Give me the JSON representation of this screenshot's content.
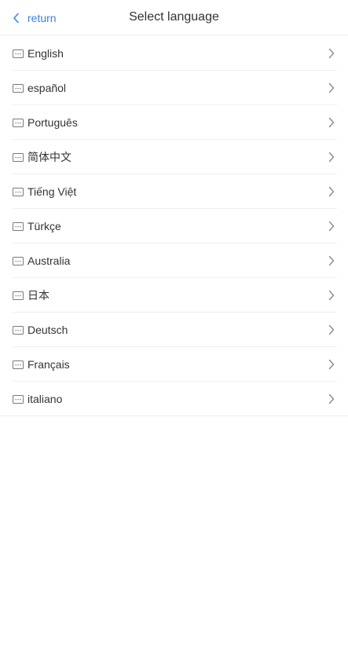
{
  "header": {
    "back_label": "return",
    "title": "Select language"
  },
  "languages": [
    {
      "label": "English"
    },
    {
      "label": "español"
    },
    {
      "label": "Português"
    },
    {
      "label": "简体中文"
    },
    {
      "label": "Tiếng Việt"
    },
    {
      "label": "Türkçe"
    },
    {
      "label": "Australia"
    },
    {
      "label": "日本"
    },
    {
      "label": "Deutsch"
    },
    {
      "label": "Français"
    },
    {
      "label": "italiano"
    }
  ],
  "icons": {
    "back": "chevron-left-icon",
    "item": "language-message-icon",
    "row_arrow": "chevron-right-icon"
  },
  "colors": {
    "accent": "#3a82e8",
    "text": "#333333",
    "divider": "#efefef",
    "icon": "#7a7a7a"
  }
}
